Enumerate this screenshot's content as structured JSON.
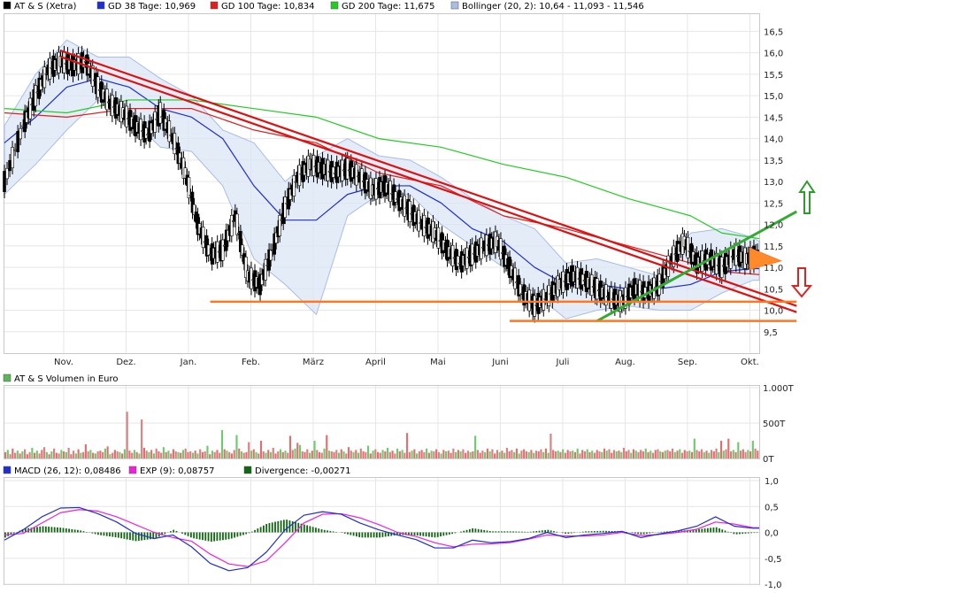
{
  "chart_data": [
    {
      "type": "line",
      "panel": "price",
      "legend": [
        {
          "label": "AT & S (Xetra)",
          "color": "#000000"
        },
        {
          "label": "GD 38 Tage: 10,969",
          "color": "#1f2fd0"
        },
        {
          "label": "GD 100 Tage: 10,834",
          "color": "#dd1f1f"
        },
        {
          "label": "GD 200 Tage: 11,675",
          "color": "#22cc22"
        },
        {
          "label": "Bollinger (20, 2): 10,64 - 11,093 - 11,546",
          "color": "#a9bde6"
        }
      ],
      "y_ticks": [
        "9,5",
        "10,0",
        "10,5",
        "11,0",
        "11,5",
        "12,0",
        "12,5",
        "13,0",
        "13,5",
        "14,0",
        "14,5",
        "15,0",
        "15,5",
        "16,0",
        "16,5"
      ],
      "ylim": [
        9.0,
        16.9
      ],
      "x_ticks": [
        "Nov.",
        "Dez.",
        "Jan.",
        "Feb.",
        "März",
        "April",
        "Mai",
        "Juni",
        "Juli",
        "Aug.",
        "Sep.",
        "Okt."
      ],
      "x_tick_months": [
        0.95,
        1.95,
        2.95,
        3.95,
        4.95,
        5.95,
        6.95,
        7.95,
        8.95,
        9.95,
        10.95,
        11.95
      ],
      "series": [
        {
          "name": "AT & S (Xetra)",
          "color": "#000000",
          "x": [
            0,
            0.3,
            0.5,
            0.7,
            0.9,
            1.1,
            1.3,
            1.5,
            1.7,
            1.9,
            2.1,
            2.3,
            2.5,
            2.7,
            2.9,
            3.1,
            3.3,
            3.5,
            3.7,
            3.9,
            4.1,
            4.3,
            4.5,
            4.7,
            4.9,
            5.1,
            5.3,
            5.5,
            5.7,
            5.9,
            6.1,
            6.3,
            6.5,
            6.7,
            6.9,
            7.1,
            7.3,
            7.5,
            7.7,
            7.9,
            8.1,
            8.3,
            8.5,
            8.7,
            8.9,
            9.1,
            9.3,
            9.5,
            9.7,
            9.9,
            10.1,
            10.3,
            10.5,
            10.7,
            10.9,
            11.1,
            11.3,
            11.5,
            11.7,
            11.9,
            12.1
          ],
          "values": [
            13.0,
            14.3,
            15.0,
            15.6,
            15.8,
            15.7,
            15.8,
            15.2,
            14.8,
            14.6,
            14.3,
            14.1,
            14.6,
            14.0,
            13.2,
            12.0,
            11.3,
            11.4,
            12.2,
            10.8,
            10.6,
            11.4,
            12.4,
            13.1,
            13.4,
            13.3,
            13.2,
            13.3,
            13.1,
            12.8,
            12.9,
            12.6,
            12.3,
            12.0,
            11.8,
            11.4,
            11.1,
            11.3,
            11.5,
            11.6,
            11.0,
            10.4,
            10.1,
            10.3,
            10.6,
            10.8,
            10.7,
            10.5,
            10.3,
            10.2,
            10.5,
            10.4,
            10.6,
            11.2,
            11.6,
            11.1,
            11.2,
            11.0,
            11.3,
            11.2,
            11.3
          ]
        },
        {
          "name": "GD 38 Tage",
          "color": "#1f2fd0",
          "x": [
            0,
            0.5,
            1.0,
            1.5,
            2.0,
            2.5,
            3.0,
            3.5,
            4.0,
            4.5,
            5.0,
            5.5,
            6.0,
            6.5,
            7.0,
            7.5,
            8.0,
            8.5,
            9.0,
            9.5,
            10.0,
            10.5,
            11.0,
            11.5,
            12.0,
            12.1
          ],
          "values": [
            13.9,
            14.5,
            15.2,
            15.4,
            15.2,
            14.7,
            14.5,
            14.0,
            12.9,
            12.1,
            12.1,
            12.7,
            12.9,
            12.9,
            12.5,
            11.9,
            11.6,
            11.0,
            10.6,
            10.6,
            10.5,
            10.5,
            10.6,
            10.9,
            10.97,
            10.97
          ]
        },
        {
          "name": "GD 100 Tage",
          "color": "#dd1f1f",
          "x": [
            0,
            1.0,
            2.0,
            3.0,
            4.0,
            5.0,
            6.0,
            7.0,
            8.0,
            9.0,
            10.0,
            11.0,
            11.5,
            12.1
          ],
          "values": [
            14.6,
            14.5,
            14.7,
            14.7,
            14.2,
            13.9,
            13.2,
            12.9,
            12.2,
            11.9,
            11.5,
            11.1,
            10.9,
            10.83
          ]
        },
        {
          "name": "GD 200 Tage",
          "color": "#22cc22",
          "x": [
            0,
            1.0,
            2.0,
            3.0,
            4.0,
            5.0,
            6.0,
            7.0,
            8.0,
            9.0,
            10.0,
            11.0,
            11.5,
            12.1
          ],
          "values": [
            14.7,
            14.6,
            14.9,
            14.9,
            14.7,
            14.5,
            14.0,
            13.8,
            13.4,
            13.1,
            12.6,
            12.2,
            11.8,
            11.67
          ]
        }
      ],
      "bollinger": {
        "x": [
          0,
          0.5,
          1.0,
          1.5,
          2.0,
          2.5,
          3.0,
          3.5,
          4.0,
          4.5,
          5.0,
          5.5,
          6.0,
          6.5,
          7.0,
          7.5,
          8.0,
          8.5,
          9.0,
          9.5,
          10.0,
          10.5,
          11.0,
          11.5,
          12.0,
          12.1
        ],
        "upper": [
          14.3,
          15.5,
          16.3,
          15.9,
          15.9,
          15.4,
          15.0,
          14.2,
          13.9,
          13.0,
          13.6,
          14.0,
          13.6,
          13.5,
          13.1,
          12.6,
          12.2,
          11.9,
          11.1,
          11.2,
          11.0,
          10.8,
          11.8,
          11.9,
          11.7,
          11.6
        ],
        "lower": [
          12.7,
          13.4,
          14.2,
          14.9,
          14.5,
          13.8,
          13.7,
          12.9,
          11.2,
          10.6,
          9.9,
          12.2,
          12.7,
          12.7,
          12.0,
          11.5,
          11.0,
          10.4,
          9.8,
          10.0,
          10.1,
          10.0,
          10.0,
          10.4,
          10.7,
          10.7
        ]
      },
      "trendlines": [
        {
          "name": "resistance",
          "color": "#dd1111",
          "x": [
            0.9,
            12.7
          ],
          "y": [
            16.05,
            10.1
          ]
        },
        {
          "name": "support-green",
          "color": "#33aa33",
          "x": [
            9.5,
            12.7
          ],
          "y": [
            9.75,
            12.3
          ]
        },
        {
          "name": "horizontal-10.2",
          "color": "#ff7722",
          "x": [
            3.3,
            12.7
          ],
          "y": [
            10.2,
            10.2
          ]
        },
        {
          "name": "horizontal-9.75",
          "color": "#ff7722",
          "x": [
            8.1,
            12.7
          ],
          "y": [
            9.75,
            9.75
          ]
        }
      ]
    },
    {
      "type": "bar",
      "panel": "volume",
      "legend": [
        {
          "label": "AT & S Volumen in Euro",
          "color": "#5bb55b"
        }
      ],
      "y_ticks": [
        "0T",
        "500T",
        "1.000T"
      ],
      "ylim": [
        0,
        1000
      ],
      "values": [
        90,
        120,
        60,
        140,
        80,
        110,
        70,
        100,
        130,
        60,
        90,
        150,
        80,
        110,
        70,
        120,
        160,
        90,
        60,
        100,
        140,
        80,
        70,
        120,
        100,
        90,
        150,
        60,
        110,
        70,
        130,
        80,
        90,
        200,
        100,
        120,
        80,
        70,
        100,
        110,
        90,
        140,
        170,
        60,
        80,
        120,
        100,
        90,
        70,
        130,
        660,
        110,
        80,
        120,
        90,
        70,
        550,
        150,
        110,
        90,
        120,
        70,
        140,
        100,
        80,
        160,
        90,
        110,
        70,
        130,
        100,
        90,
        80,
        120,
        140,
        90,
        100,
        80,
        110,
        70,
        130,
        90,
        100,
        180,
        60,
        110,
        90,
        120,
        80,
        400,
        130,
        110,
        90,
        70,
        120,
        330,
        140,
        100,
        80,
        90,
        230,
        110,
        130,
        90,
        70,
        250,
        100,
        80,
        120,
        90,
        150,
        70,
        100,
        130,
        90,
        110,
        80,
        320,
        120,
        140,
        220,
        190,
        100,
        90,
        130,
        80,
        110,
        250,
        120,
        90,
        80,
        140,
        330,
        110,
        100,
        90,
        120,
        80,
        130,
        100,
        70,
        160,
        110,
        90,
        120,
        80,
        140,
        100,
        90,
        180,
        70,
        110,
        130,
        90,
        80,
        120,
        100,
        150,
        90,
        110,
        70,
        140,
        100,
        120,
        80,
        360,
        90,
        110,
        130,
        70,
        100,
        120,
        90,
        140,
        80,
        110,
        100,
        130,
        90,
        70,
        120,
        100,
        110,
        80,
        140,
        90,
        120,
        100,
        130,
        80,
        110,
        90,
        100,
        320,
        120,
        80,
        110,
        90,
        140,
        100,
        130,
        70,
        120,
        90,
        110,
        80,
        150,
        100,
        120,
        90,
        140,
        70,
        110,
        130,
        100,
        90,
        120,
        80,
        110,
        100,
        130,
        90,
        140,
        80,
        350,
        120,
        100,
        110,
        90,
        130,
        80,
        120,
        100,
        110,
        90,
        140,
        70,
        120,
        100,
        130,
        90,
        110,
        80,
        120,
        100,
        90,
        140,
        110,
        130,
        80,
        120,
        100,
        110,
        90,
        150,
        100,
        120,
        80,
        130,
        110,
        90,
        120,
        100,
        140,
        90,
        110,
        80,
        120,
        130,
        100,
        90,
        110,
        120,
        100,
        140,
        90,
        110,
        130,
        80,
        120,
        100,
        110,
        90,
        280,
        120,
        100,
        130,
        90,
        110,
        80,
        120,
        100,
        140,
        90,
        250,
        110,
        130,
        280,
        100,
        120,
        90,
        230,
        110,
        130,
        90,
        120,
        100,
        250,
        140,
        110
      ]
    },
    {
      "type": "line",
      "panel": "macd",
      "legend": [
        {
          "label": "MACD (26, 12): 0,08486",
          "color": "#1f2fd0"
        },
        {
          "label": "EXP (9): 0,08757",
          "color": "#ee22dd"
        },
        {
          "label": "Divergence: -0,00271",
          "color": "#116611"
        }
      ],
      "y_ticks": [
        "-1,0",
        "-0,5",
        "0,0",
        "0,5",
        "1,0"
      ],
      "ylim": [
        -1.0,
        1.0
      ],
      "x": [
        0,
        0.3,
        0.6,
        0.9,
        1.2,
        1.5,
        1.8,
        2.1,
        2.4,
        2.7,
        3.0,
        3.3,
        3.6,
        3.9,
        4.2,
        4.5,
        4.8,
        5.1,
        5.4,
        5.7,
        6.0,
        6.3,
        6.6,
        6.9,
        7.2,
        7.5,
        7.8,
        8.1,
        8.4,
        8.7,
        9.0,
        9.3,
        9.6,
        9.9,
        10.2,
        10.5,
        10.8,
        11.1,
        11.4,
        11.7,
        12.0,
        12.1
      ],
      "series": [
        {
          "name": "MACD",
          "color": "#1f2fd0",
          "values": [
            -0.15,
            0.05,
            0.3,
            0.47,
            0.48,
            0.36,
            0.2,
            -0.02,
            -0.12,
            -0.05,
            -0.28,
            -0.6,
            -0.74,
            -0.68,
            -0.38,
            0.05,
            0.33,
            0.4,
            0.35,
            0.18,
            0.05,
            -0.05,
            -0.14,
            -0.3,
            -0.3,
            -0.15,
            -0.2,
            -0.18,
            -0.12,
            0.0,
            -0.1,
            -0.05,
            -0.02,
            0.02,
            -0.1,
            -0.03,
            0.03,
            0.12,
            0.3,
            0.12,
            0.08,
            0.08
          ]
        },
        {
          "name": "EXP",
          "color": "#ee22dd",
          "values": [
            -0.05,
            -0.02,
            0.18,
            0.38,
            0.44,
            0.41,
            0.3,
            0.15,
            0.0,
            -0.1,
            -0.17,
            -0.42,
            -0.61,
            -0.66,
            -0.55,
            -0.2,
            0.18,
            0.35,
            0.36,
            0.28,
            0.15,
            0.0,
            -0.08,
            -0.2,
            -0.28,
            -0.23,
            -0.22,
            -0.2,
            -0.13,
            -0.05,
            -0.07,
            -0.07,
            -0.05,
            0.0,
            -0.06,
            -0.04,
            0.0,
            0.06,
            0.2,
            0.16,
            0.09,
            0.09
          ]
        },
        {
          "name": "Divergence",
          "color": "#116611",
          "values": [
            -0.1,
            0.07,
            0.12,
            0.09,
            0.04,
            -0.05,
            -0.1,
            -0.17,
            -0.12,
            0.05,
            -0.11,
            -0.18,
            -0.13,
            -0.02,
            0.17,
            0.25,
            0.15,
            0.05,
            -0.01,
            -0.1,
            -0.1,
            -0.05,
            -0.06,
            -0.1,
            -0.02,
            0.08,
            0.02,
            0.02,
            0.01,
            0.05,
            -0.03,
            0.02,
            0.03,
            0.02,
            -0.04,
            0.01,
            0.03,
            0.06,
            0.1,
            -0.04,
            -0.01,
            -0.01
          ]
        }
      ]
    }
  ]
}
